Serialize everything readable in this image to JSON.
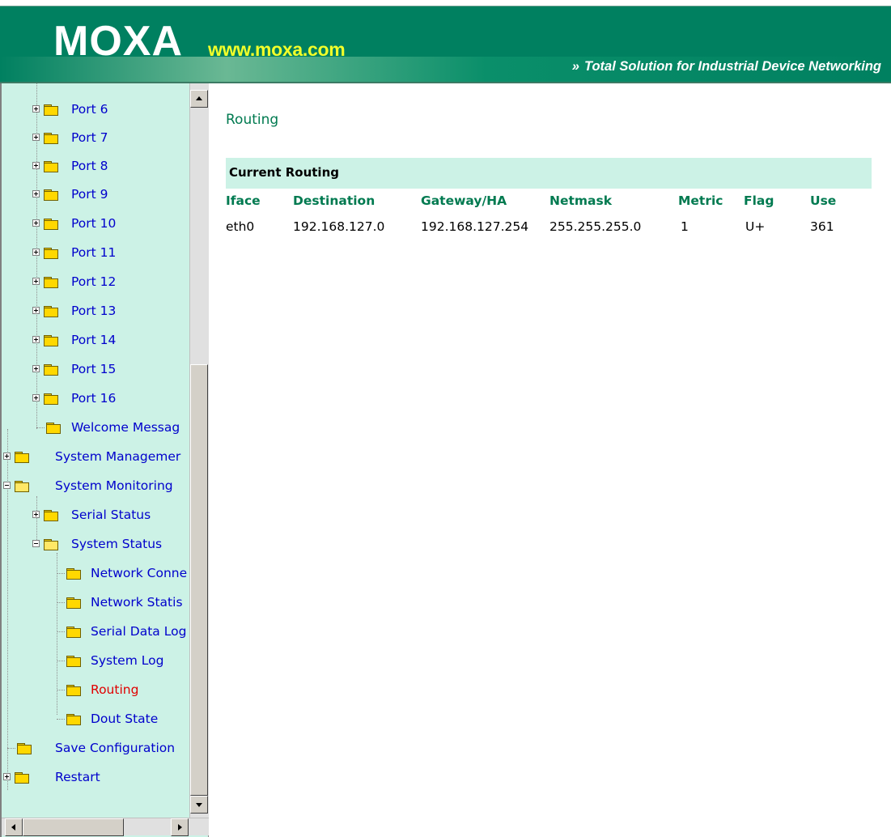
{
  "header": {
    "logo": "MOXA",
    "url": "www.moxa.com",
    "tagline_chevron": "»",
    "tagline": "Total Solution for Industrial Device Networking"
  },
  "sidebar": {
    "items": [
      {
        "label": "Port 6",
        "expander": "plus",
        "state": "closed"
      },
      {
        "label": "Port 7",
        "expander": "plus",
        "state": "closed"
      },
      {
        "label": "Port 8",
        "expander": "plus",
        "state": "closed"
      },
      {
        "label": "Port 9",
        "expander": "plus",
        "state": "closed"
      },
      {
        "label": "Port 10",
        "expander": "plus",
        "state": "closed"
      },
      {
        "label": "Port 11",
        "expander": "plus",
        "state": "closed"
      },
      {
        "label": "Port 12",
        "expander": "plus",
        "state": "closed"
      },
      {
        "label": "Port 13",
        "expander": "plus",
        "state": "closed"
      },
      {
        "label": "Port 14",
        "expander": "plus",
        "state": "closed"
      },
      {
        "label": "Port 15",
        "expander": "plus",
        "state": "closed"
      },
      {
        "label": "Port 16",
        "expander": "plus",
        "state": "closed"
      },
      {
        "label": "Welcome Messag",
        "expander": "none",
        "state": "closed"
      },
      {
        "label": "System Managemer",
        "expander": "plus",
        "state": "closed"
      },
      {
        "label": "System Monitoring",
        "expander": "minus",
        "state": "open"
      },
      {
        "label": "Serial Status",
        "expander": "plus",
        "state": "closed"
      },
      {
        "label": "System Status",
        "expander": "minus",
        "state": "open"
      },
      {
        "label": "Network Conne",
        "expander": "none",
        "state": "closed"
      },
      {
        "label": "Network Statis",
        "expander": "none",
        "state": "closed"
      },
      {
        "label": "Serial Data Log",
        "expander": "none",
        "state": "closed"
      },
      {
        "label": "System Log",
        "expander": "none",
        "state": "closed"
      },
      {
        "label": "Routing",
        "expander": "none",
        "state": "closed",
        "selected": true
      },
      {
        "label": "Dout State",
        "expander": "none",
        "state": "closed"
      },
      {
        "label": "Save Configuration",
        "expander": "none",
        "state": "closed"
      },
      {
        "label": "Restart",
        "expander": "plus",
        "state": "closed"
      }
    ]
  },
  "main": {
    "title": "Routing",
    "section_title": "Current Routing",
    "columns": [
      "Iface",
      "Destination",
      "Gateway/HA",
      "Netmask",
      "Metric",
      "Flag",
      "Use"
    ],
    "rows": [
      [
        "eth0",
        "192.168.127.0",
        "192.168.127.254",
        "255.255.255.0",
        "1",
        "U+",
        "361"
      ]
    ]
  },
  "colors": {
    "header_green": "#008060",
    "sidebar_bg": "#ccf2e6",
    "link_blue": "#0000cc",
    "selected_red": "#e00000",
    "heading_green": "#007a50",
    "url_yellow": "#f2ff2a"
  }
}
